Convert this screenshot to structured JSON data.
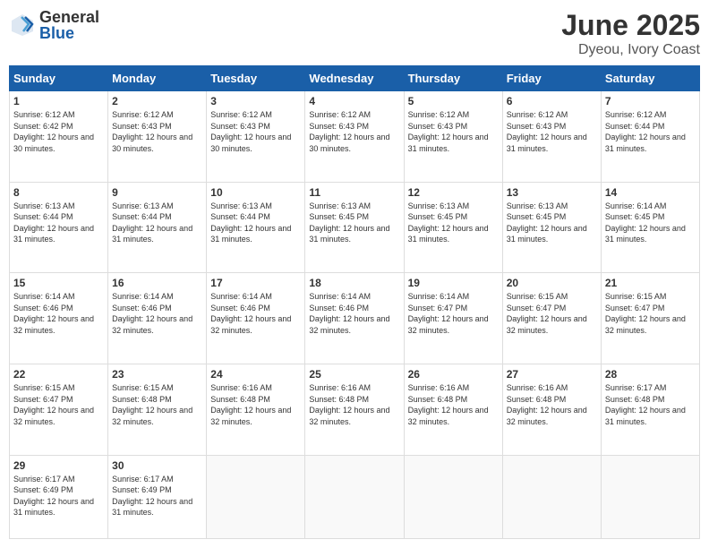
{
  "logo": {
    "general": "General",
    "blue": "Blue"
  },
  "title": "June 2025",
  "subtitle": "Dyeou, Ivory Coast",
  "days_of_week": [
    "Sunday",
    "Monday",
    "Tuesday",
    "Wednesday",
    "Thursday",
    "Friday",
    "Saturday"
  ],
  "weeks": [
    [
      {
        "day": "1",
        "sunrise": "6:12 AM",
        "sunset": "6:42 PM",
        "daylight": "12 hours and 30 minutes."
      },
      {
        "day": "2",
        "sunrise": "6:12 AM",
        "sunset": "6:43 PM",
        "daylight": "12 hours and 30 minutes."
      },
      {
        "day": "3",
        "sunrise": "6:12 AM",
        "sunset": "6:43 PM",
        "daylight": "12 hours and 30 minutes."
      },
      {
        "day": "4",
        "sunrise": "6:12 AM",
        "sunset": "6:43 PM",
        "daylight": "12 hours and 30 minutes."
      },
      {
        "day": "5",
        "sunrise": "6:12 AM",
        "sunset": "6:43 PM",
        "daylight": "12 hours and 31 minutes."
      },
      {
        "day": "6",
        "sunrise": "6:12 AM",
        "sunset": "6:43 PM",
        "daylight": "12 hours and 31 minutes."
      },
      {
        "day": "7",
        "sunrise": "6:12 AM",
        "sunset": "6:44 PM",
        "daylight": "12 hours and 31 minutes."
      }
    ],
    [
      {
        "day": "8",
        "sunrise": "6:13 AM",
        "sunset": "6:44 PM",
        "daylight": "12 hours and 31 minutes."
      },
      {
        "day": "9",
        "sunrise": "6:13 AM",
        "sunset": "6:44 PM",
        "daylight": "12 hours and 31 minutes."
      },
      {
        "day": "10",
        "sunrise": "6:13 AM",
        "sunset": "6:44 PM",
        "daylight": "12 hours and 31 minutes."
      },
      {
        "day": "11",
        "sunrise": "6:13 AM",
        "sunset": "6:45 PM",
        "daylight": "12 hours and 31 minutes."
      },
      {
        "day": "12",
        "sunrise": "6:13 AM",
        "sunset": "6:45 PM",
        "daylight": "12 hours and 31 minutes."
      },
      {
        "day": "13",
        "sunrise": "6:13 AM",
        "sunset": "6:45 PM",
        "daylight": "12 hours and 31 minutes."
      },
      {
        "day": "14",
        "sunrise": "6:14 AM",
        "sunset": "6:45 PM",
        "daylight": "12 hours and 31 minutes."
      }
    ],
    [
      {
        "day": "15",
        "sunrise": "6:14 AM",
        "sunset": "6:46 PM",
        "daylight": "12 hours and 32 minutes."
      },
      {
        "day": "16",
        "sunrise": "6:14 AM",
        "sunset": "6:46 PM",
        "daylight": "12 hours and 32 minutes."
      },
      {
        "day": "17",
        "sunrise": "6:14 AM",
        "sunset": "6:46 PM",
        "daylight": "12 hours and 32 minutes."
      },
      {
        "day": "18",
        "sunrise": "6:14 AM",
        "sunset": "6:46 PM",
        "daylight": "12 hours and 32 minutes."
      },
      {
        "day": "19",
        "sunrise": "6:14 AM",
        "sunset": "6:47 PM",
        "daylight": "12 hours and 32 minutes."
      },
      {
        "day": "20",
        "sunrise": "6:15 AM",
        "sunset": "6:47 PM",
        "daylight": "12 hours and 32 minutes."
      },
      {
        "day": "21",
        "sunrise": "6:15 AM",
        "sunset": "6:47 PM",
        "daylight": "12 hours and 32 minutes."
      }
    ],
    [
      {
        "day": "22",
        "sunrise": "6:15 AM",
        "sunset": "6:47 PM",
        "daylight": "12 hours and 32 minutes."
      },
      {
        "day": "23",
        "sunrise": "6:15 AM",
        "sunset": "6:48 PM",
        "daylight": "12 hours and 32 minutes."
      },
      {
        "day": "24",
        "sunrise": "6:16 AM",
        "sunset": "6:48 PM",
        "daylight": "12 hours and 32 minutes."
      },
      {
        "day": "25",
        "sunrise": "6:16 AM",
        "sunset": "6:48 PM",
        "daylight": "12 hours and 32 minutes."
      },
      {
        "day": "26",
        "sunrise": "6:16 AM",
        "sunset": "6:48 PM",
        "daylight": "12 hours and 32 minutes."
      },
      {
        "day": "27",
        "sunrise": "6:16 AM",
        "sunset": "6:48 PM",
        "daylight": "12 hours and 32 minutes."
      },
      {
        "day": "28",
        "sunrise": "6:17 AM",
        "sunset": "6:48 PM",
        "daylight": "12 hours and 31 minutes."
      }
    ],
    [
      {
        "day": "29",
        "sunrise": "6:17 AM",
        "sunset": "6:49 PM",
        "daylight": "12 hours and 31 minutes."
      },
      {
        "day": "30",
        "sunrise": "6:17 AM",
        "sunset": "6:49 PM",
        "daylight": "12 hours and 31 minutes."
      },
      null,
      null,
      null,
      null,
      null
    ]
  ]
}
